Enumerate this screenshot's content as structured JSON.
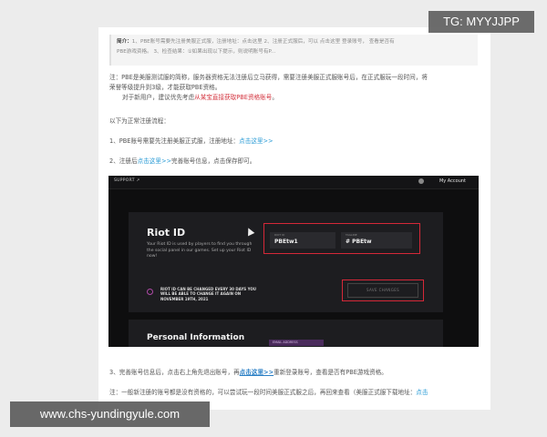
{
  "summary": {
    "label": "简介：",
    "line1": "1、PBE账号需要先注册美服正式服，注册地址：点击这里 2、注册正式服后，可以 点击这里 登录账号， 查看是否有",
    "line2": "PBE游戏资格。 3、检查结果：①如果出现以下提示，则说明账号有P..."
  },
  "note1": {
    "text1": "注：PBE是美服测试服的简称，服务器资格无法注册后立马获得，需要注册美服正式服账号后，在正式服玩一段时间，将",
    "text2": "荣誉等级提升到3级，才能获取PBE资格。",
    "text3_prefix": "对于新用户，建议优先考虑",
    "text3_red": "从某宝直接获取PBE资格账号",
    "text3_suffix": "。"
  },
  "flow_title": "以下为正常注册流程：",
  "step1": {
    "prefix": "1、PBE账号需要先注册美服正式服，注册地址：",
    "link": "点击这里>>"
  },
  "step2": {
    "prefix": "2、注册后",
    "link": "点击这里>>",
    "suffix": "完善账号信息，点击保存即可。"
  },
  "screenshot": {
    "topbar_left": "SUPPORT ↗",
    "account": "My Account",
    "riot_title": "Riot ID",
    "riot_desc": "Your Riot ID is used by players to find you through the social panel in our games. Set up your Riot ID now!",
    "notice": "RIOT ID CAN BE CHANGED EVERY 30 DAYS YOU WILL BE ABLE TO CHANGE IT AGAIN ON NOVEMBER 19TH, 2021",
    "field1_label": "RIOT ID",
    "field1_value": "PBEtw1",
    "field2_label": "TAGLINE",
    "field2_value": "# PBEtw",
    "save_button": "SAVE CHANGES",
    "pi_title": "Personal Information",
    "pi_bar": "EMAIL ADDRESS"
  },
  "step3": {
    "prefix": "3、完善账号信息后，点击右上角先退出账号，再",
    "link": "点击这里>>",
    "suffix": "重新登录账号，查看是否有PBE游戏资格。"
  },
  "note2": {
    "text": "注：一般新注册的账号都是没有资格的，可以尝试玩一段时间美服正式服之后，再回来查看（美服正式服下载地址：",
    "link": "点击"
  },
  "watermark_top": "TG: MYYJJPP",
  "watermark_bottom": "www.chs-yundingyule.com",
  "colors": {
    "red": "#d3303b",
    "link": "#2a9bd6",
    "dark_bg": "#0e0e0f",
    "watermark": "#5c5c5c"
  }
}
